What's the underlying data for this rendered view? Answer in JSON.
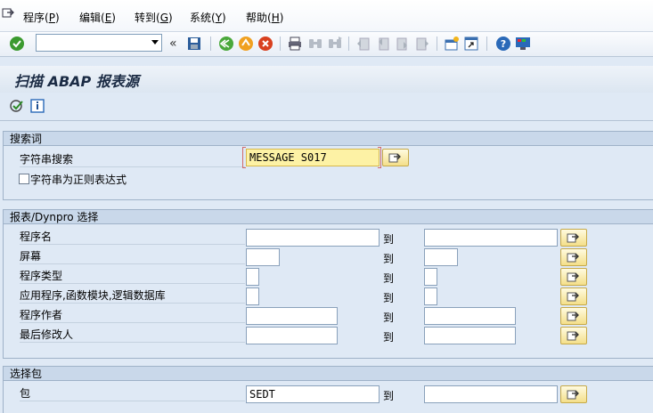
{
  "menu": {
    "items": [
      {
        "label": "程序(",
        "key": "P",
        "tail": ")"
      },
      {
        "label": "编辑(",
        "key": "E",
        "tail": ")"
      },
      {
        "label": "转到(",
        "key": "G",
        "tail": ")"
      },
      {
        "label": "系统(",
        "key": "Y",
        "tail": ")"
      },
      {
        "label": "帮助(",
        "key": "H",
        "tail": ")"
      }
    ]
  },
  "toolbar": {
    "command_value": "",
    "chevron": "«",
    "icons": [
      "enter-icon",
      "save-icon",
      "back-icon",
      "exit-icon",
      "cancel-icon",
      "print-icon",
      "find-icon",
      "find-next-icon",
      "first-page-icon",
      "previous-page-icon",
      "next-page-icon",
      "last-page-icon",
      "new-session-icon",
      "shortcut-icon",
      "help-icon",
      "customize-layout-icon"
    ]
  },
  "title": "扫描 ABAP 报表源",
  "appbar": {
    "icons": [
      "execute-icon",
      "info-icon"
    ]
  },
  "search": {
    "header": "搜索词",
    "string_label": "字符串搜索",
    "string_value": "MESSAGE S017",
    "regex_label": "字符串为正则表达式",
    "regex_checked": false
  },
  "report": {
    "header": "报表/Dynpro 选择",
    "to_label": "到",
    "rows": [
      {
        "label": "程序名",
        "from": "",
        "to": ""
      },
      {
        "label": "屏幕",
        "from": "",
        "to": ""
      },
      {
        "label": "程序类型",
        "from": "",
        "to": ""
      },
      {
        "label": "应用程序,函数模块,逻辑数据库",
        "from": "",
        "to": ""
      },
      {
        "label": "程序作者",
        "from": "",
        "to": ""
      },
      {
        "label": "最后修改人",
        "from": "",
        "to": ""
      }
    ]
  },
  "package": {
    "header": "选择包",
    "to_label": "到",
    "label": "包",
    "from": "SEDT",
    "to": ""
  },
  "colors": {
    "background": "#dfe9f5",
    "group_header": "#c9d8ea",
    "highlight_field": "#fdf2a5",
    "select_button": "#f4df8a"
  }
}
